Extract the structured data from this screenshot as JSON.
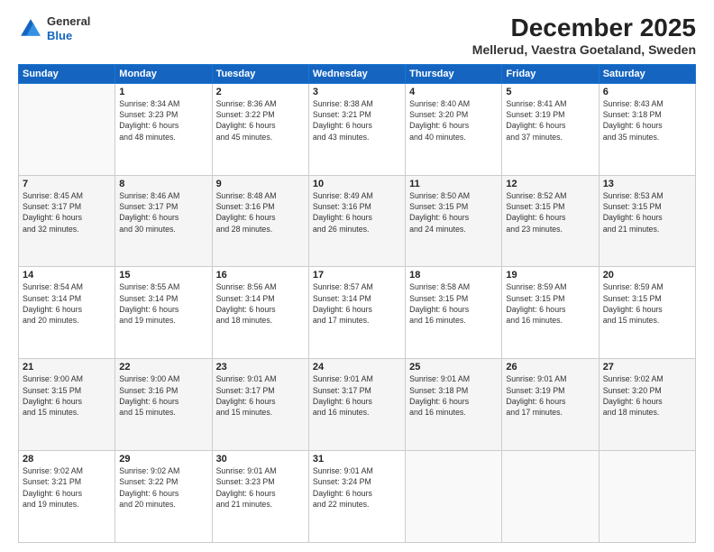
{
  "logo": {
    "general": "General",
    "blue": "Blue"
  },
  "title": "December 2025",
  "subtitle": "Mellerud, Vaestra Goetaland, Sweden",
  "weekdays": [
    "Sunday",
    "Monday",
    "Tuesday",
    "Wednesday",
    "Thursday",
    "Friday",
    "Saturday"
  ],
  "weeks": [
    [
      {
        "day": "",
        "info": ""
      },
      {
        "day": "1",
        "info": "Sunrise: 8:34 AM\nSunset: 3:23 PM\nDaylight: 6 hours\nand 48 minutes."
      },
      {
        "day": "2",
        "info": "Sunrise: 8:36 AM\nSunset: 3:22 PM\nDaylight: 6 hours\nand 45 minutes."
      },
      {
        "day": "3",
        "info": "Sunrise: 8:38 AM\nSunset: 3:21 PM\nDaylight: 6 hours\nand 43 minutes."
      },
      {
        "day": "4",
        "info": "Sunrise: 8:40 AM\nSunset: 3:20 PM\nDaylight: 6 hours\nand 40 minutes."
      },
      {
        "day": "5",
        "info": "Sunrise: 8:41 AM\nSunset: 3:19 PM\nDaylight: 6 hours\nand 37 minutes."
      },
      {
        "day": "6",
        "info": "Sunrise: 8:43 AM\nSunset: 3:18 PM\nDaylight: 6 hours\nand 35 minutes."
      }
    ],
    [
      {
        "day": "7",
        "info": "Sunrise: 8:45 AM\nSunset: 3:17 PM\nDaylight: 6 hours\nand 32 minutes."
      },
      {
        "day": "8",
        "info": "Sunrise: 8:46 AM\nSunset: 3:17 PM\nDaylight: 6 hours\nand 30 minutes."
      },
      {
        "day": "9",
        "info": "Sunrise: 8:48 AM\nSunset: 3:16 PM\nDaylight: 6 hours\nand 28 minutes."
      },
      {
        "day": "10",
        "info": "Sunrise: 8:49 AM\nSunset: 3:16 PM\nDaylight: 6 hours\nand 26 minutes."
      },
      {
        "day": "11",
        "info": "Sunrise: 8:50 AM\nSunset: 3:15 PM\nDaylight: 6 hours\nand 24 minutes."
      },
      {
        "day": "12",
        "info": "Sunrise: 8:52 AM\nSunset: 3:15 PM\nDaylight: 6 hours\nand 23 minutes."
      },
      {
        "day": "13",
        "info": "Sunrise: 8:53 AM\nSunset: 3:15 PM\nDaylight: 6 hours\nand 21 minutes."
      }
    ],
    [
      {
        "day": "14",
        "info": "Sunrise: 8:54 AM\nSunset: 3:14 PM\nDaylight: 6 hours\nand 20 minutes."
      },
      {
        "day": "15",
        "info": "Sunrise: 8:55 AM\nSunset: 3:14 PM\nDaylight: 6 hours\nand 19 minutes."
      },
      {
        "day": "16",
        "info": "Sunrise: 8:56 AM\nSunset: 3:14 PM\nDaylight: 6 hours\nand 18 minutes."
      },
      {
        "day": "17",
        "info": "Sunrise: 8:57 AM\nSunset: 3:14 PM\nDaylight: 6 hours\nand 17 minutes."
      },
      {
        "day": "18",
        "info": "Sunrise: 8:58 AM\nSunset: 3:15 PM\nDaylight: 6 hours\nand 16 minutes."
      },
      {
        "day": "19",
        "info": "Sunrise: 8:59 AM\nSunset: 3:15 PM\nDaylight: 6 hours\nand 16 minutes."
      },
      {
        "day": "20",
        "info": "Sunrise: 8:59 AM\nSunset: 3:15 PM\nDaylight: 6 hours\nand 15 minutes."
      }
    ],
    [
      {
        "day": "21",
        "info": "Sunrise: 9:00 AM\nSunset: 3:15 PM\nDaylight: 6 hours\nand 15 minutes."
      },
      {
        "day": "22",
        "info": "Sunrise: 9:00 AM\nSunset: 3:16 PM\nDaylight: 6 hours\nand 15 minutes."
      },
      {
        "day": "23",
        "info": "Sunrise: 9:01 AM\nSunset: 3:17 PM\nDaylight: 6 hours\nand 15 minutes."
      },
      {
        "day": "24",
        "info": "Sunrise: 9:01 AM\nSunset: 3:17 PM\nDaylight: 6 hours\nand 16 minutes."
      },
      {
        "day": "25",
        "info": "Sunrise: 9:01 AM\nSunset: 3:18 PM\nDaylight: 6 hours\nand 16 minutes."
      },
      {
        "day": "26",
        "info": "Sunrise: 9:01 AM\nSunset: 3:19 PM\nDaylight: 6 hours\nand 17 minutes."
      },
      {
        "day": "27",
        "info": "Sunrise: 9:02 AM\nSunset: 3:20 PM\nDaylight: 6 hours\nand 18 minutes."
      }
    ],
    [
      {
        "day": "28",
        "info": "Sunrise: 9:02 AM\nSunset: 3:21 PM\nDaylight: 6 hours\nand 19 minutes."
      },
      {
        "day": "29",
        "info": "Sunrise: 9:02 AM\nSunset: 3:22 PM\nDaylight: 6 hours\nand 20 minutes."
      },
      {
        "day": "30",
        "info": "Sunrise: 9:01 AM\nSunset: 3:23 PM\nDaylight: 6 hours\nand 21 minutes."
      },
      {
        "day": "31",
        "info": "Sunrise: 9:01 AM\nSunset: 3:24 PM\nDaylight: 6 hours\nand 22 minutes."
      },
      {
        "day": "",
        "info": ""
      },
      {
        "day": "",
        "info": ""
      },
      {
        "day": "",
        "info": ""
      }
    ]
  ]
}
